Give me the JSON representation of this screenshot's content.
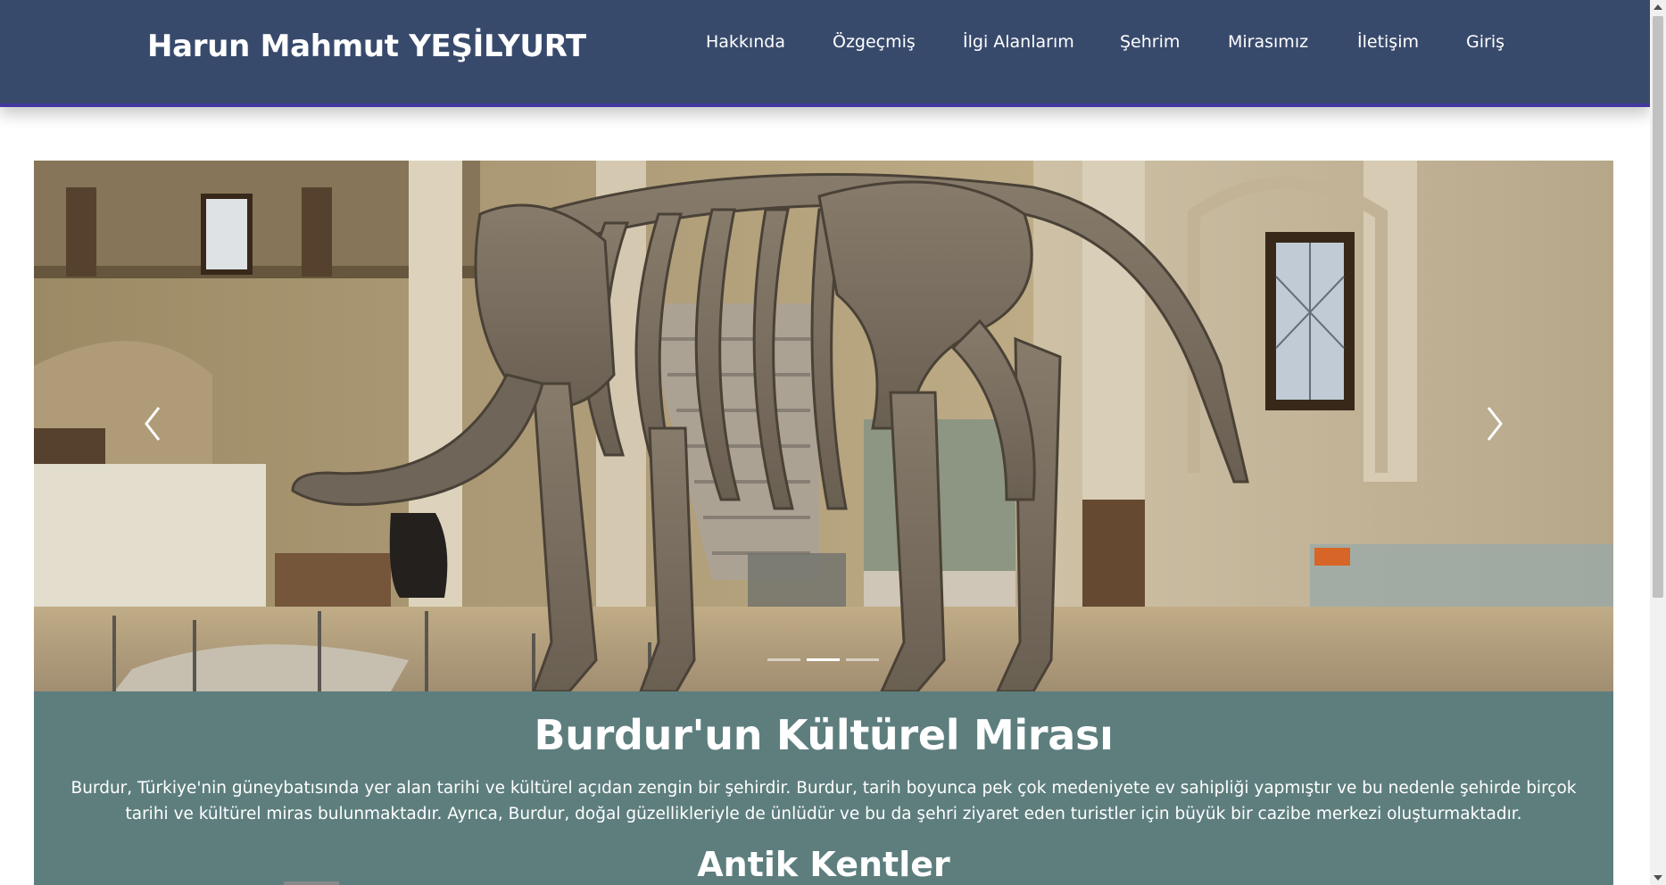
{
  "header": {
    "brand": "Harun Mahmut YEŞİLYURT",
    "nav": [
      {
        "label": "Hakkında"
      },
      {
        "label": "Özgeçmiş"
      },
      {
        "label": "İlgi Alanlarım"
      },
      {
        "label": "Şehrim"
      },
      {
        "label": "Mirasımız"
      },
      {
        "label": "İletişim"
      },
      {
        "label": "Giriş"
      }
    ],
    "colors": {
      "background": "#384a6c",
      "accent_border": "#41399e"
    }
  },
  "carousel": {
    "slide_count": 3,
    "active_index": 1,
    "image_subject": "mammoth-skeleton-museum-photo",
    "prev_icon": "chevron-left-icon",
    "next_icon": "chevron-right-icon"
  },
  "panel": {
    "title": "Burdur'un Kültürel Mirası",
    "text": "Burdur, Türkiye'nin güneybatısında yer alan tarihi ve kültürel açıdan zengin bir şehirdir. Burdur, tarih boyunca pek çok medeniyete ev sahipliği yapmıştır ve bu nedenle şehirde birçok tarihi ve kültürel miras bulunmaktadır. Ayrıca, Burdur, doğal güzellikleriyle de ünlüdür ve bu da şehri ziyaret eden turistler için büyük bir cazibe merkezi oluşturmaktadır.",
    "subtitle": "Antik Kentler",
    "background": "#5e7e7e"
  }
}
